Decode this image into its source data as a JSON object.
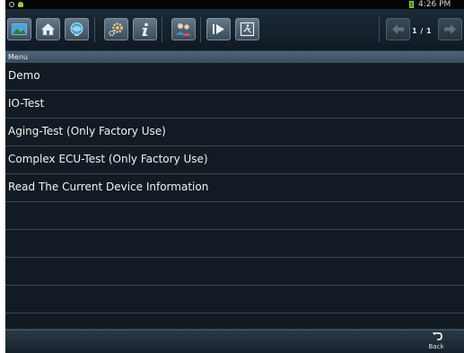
{
  "status_bar": {
    "time": "4:26 PM"
  },
  "toolbar": {
    "buttons": [
      {
        "name": "picture-icon"
      },
      {
        "name": "home-icon"
      },
      {
        "name": "display-icon"
      },
      {
        "name": "settings-icon"
      },
      {
        "name": "info-icon"
      },
      {
        "name": "users-icon"
      },
      {
        "name": "play-icon"
      },
      {
        "name": "exit-icon"
      }
    ],
    "page_indicator": "1 / 1"
  },
  "menu": {
    "title": "Menu",
    "items": [
      {
        "label": "Demo"
      },
      {
        "label": "IO-Test"
      },
      {
        "label": "Aging-Test (Only Factory Use)"
      },
      {
        "label": "Complex ECU-Test (Only Factory Use)"
      },
      {
        "label": "Read The Current Device Information"
      },
      {
        "label": ""
      },
      {
        "label": ""
      },
      {
        "label": ""
      },
      {
        "label": ""
      },
      {
        "label": ""
      }
    ]
  },
  "bottom_bar": {
    "back_label": "Back"
  },
  "colors": {
    "background": "#0e151c",
    "header": "#4f6577",
    "row_divider": "#3a4753"
  }
}
